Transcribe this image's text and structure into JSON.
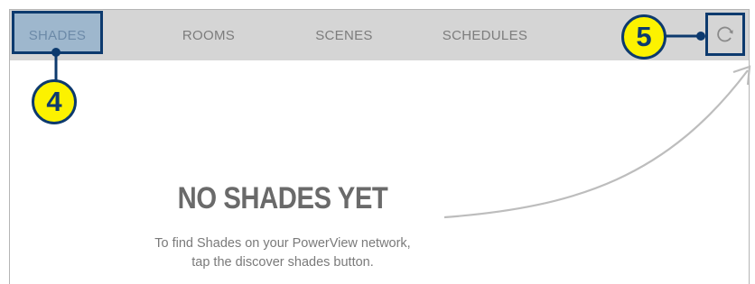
{
  "tabs": [
    {
      "label": "SHADES",
      "active": true
    },
    {
      "label": "ROOMS",
      "active": false
    },
    {
      "label": "SCENES",
      "active": false
    },
    {
      "label": "SCHEDULES",
      "active": false
    }
  ],
  "refresh_icon": "refresh-icon",
  "callouts": {
    "tab_shades": "4",
    "refresh": "5"
  },
  "empty_state": {
    "title": "NO SHADES YET",
    "message_line1": "To find Shades on your PowerView network,",
    "message_line2": "tap the discover shades button."
  },
  "colors": {
    "navbar": "#d5d5d5",
    "highlight_border": "#0d3a6e",
    "active_tab_fill": "#9eb7cd",
    "callout_fill": "#fcf200"
  }
}
